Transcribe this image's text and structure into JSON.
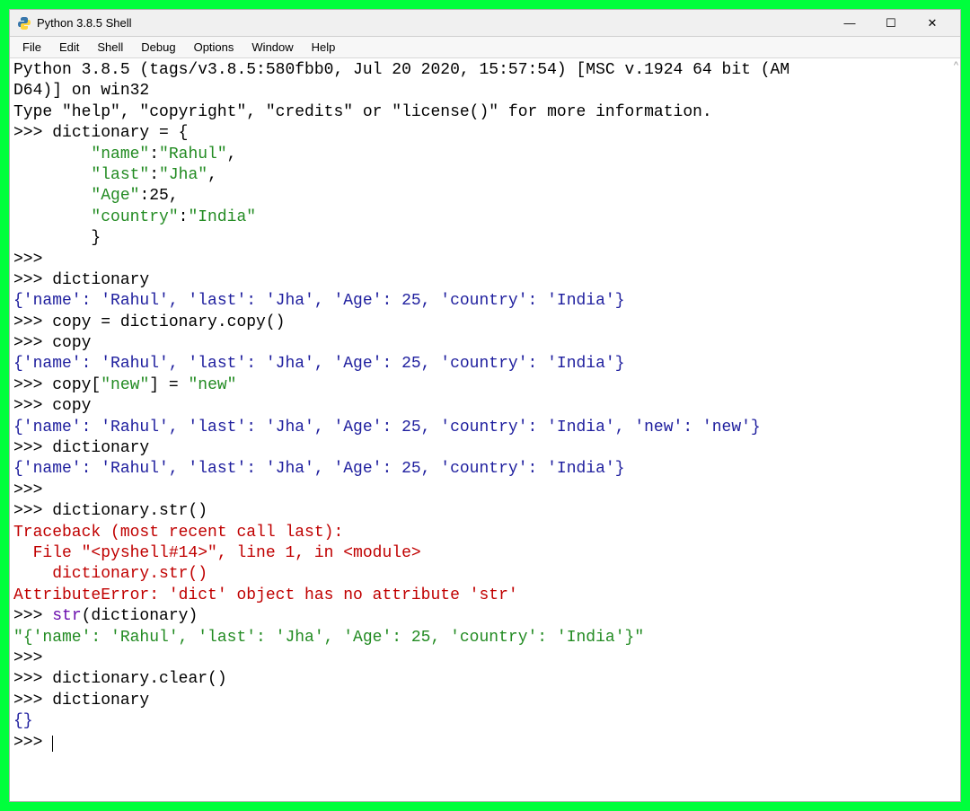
{
  "window": {
    "title": "Python 3.8.5 Shell",
    "controls": {
      "minimize": "—",
      "maximize": "☐",
      "close": "✕"
    }
  },
  "menu": {
    "file": "File",
    "edit": "Edit",
    "shell": "Shell",
    "debug": "Debug",
    "options": "Options",
    "window": "Window",
    "help": "Help"
  },
  "shell": {
    "banner1": "Python 3.8.5 (tags/v3.8.5:580fbb0, Jul 20 2020, 15:57:54) [MSC v.1924 64 bit (AM",
    "banner2": "D64)] on win32",
    "banner3": "Type \"help\", \"copyright\", \"credits\" or \"license()\" for more information.",
    "prompt": ">>> ",
    "line1": "dictionary = {",
    "k1": "\"name\"",
    "v1": "\"Rahul\"",
    "k2": "\"last\"",
    "v2": "\"Jha\"",
    "k3": "\"Age\"",
    "v3": "25",
    "k4": "\"country\"",
    "v4": "\"India\"",
    "close_brace": "}",
    "line_dict": "dictionary",
    "out1": "{'name': 'Rahul', 'last': 'Jha', 'Age': 25, 'country': 'India'}",
    "line_copy": "copy = dictionary.copy()",
    "line_copyvar": "copy",
    "out2": "{'name': 'Rahul', 'last': 'Jha', 'Age': 25, 'country': 'India'}",
    "line_assign_pre": "copy[",
    "line_assign_key": "\"new\"",
    "line_assign_mid": "] = ",
    "line_assign_val": "\"new\"",
    "out3": "{'name': 'Rahul', 'last': 'Jha', 'Age': 25, 'country': 'India', 'new': 'new'}",
    "out4": "{'name': 'Rahul', 'last': 'Jha', 'Age': 25, 'country': 'India'}",
    "line_str": "dictionary.str()",
    "err1": "Traceback (most recent call last):",
    "err2": "  File \"<pyshell#14>\", line 1, in <module>",
    "err3": "    dictionary.str()",
    "err4": "AttributeError: 'dict' object has no attribute 'str'",
    "line_str2_pre": "",
    "line_str2_builtin": "str",
    "line_str2_post": "(dictionary)",
    "out5": "\"{'name': 'Rahul', 'last': 'Jha', 'Age': 25, 'country': 'India'}\"",
    "line_clear": "dictionary.clear()",
    "out6": "{}",
    "scroll_indicator": "^"
  }
}
